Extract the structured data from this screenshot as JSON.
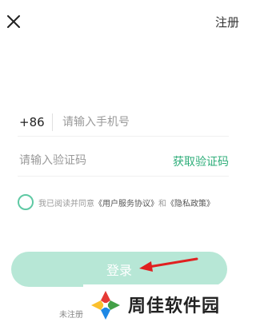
{
  "header": {
    "close_icon": "close-icon",
    "register_label": "注册"
  },
  "phone": {
    "country_code": "+86",
    "placeholder": "请输入手机号",
    "value": ""
  },
  "code": {
    "placeholder": "请输入验证码",
    "value": "",
    "get_code_label": "获取验证码"
  },
  "agreement": {
    "checked": false,
    "prefix": "我已阅读并同意",
    "user_agreement": "《用户服务协议》",
    "and": "和",
    "privacy_policy": "《隐私政策》"
  },
  "login": {
    "label": "登录"
  },
  "footer": {
    "hint": "未注册"
  },
  "watermark": {
    "text": "周佳软件园"
  },
  "colors": {
    "accent": "#2fae7a",
    "login_button": "#b7e7d6",
    "arrow": "#e02020"
  }
}
